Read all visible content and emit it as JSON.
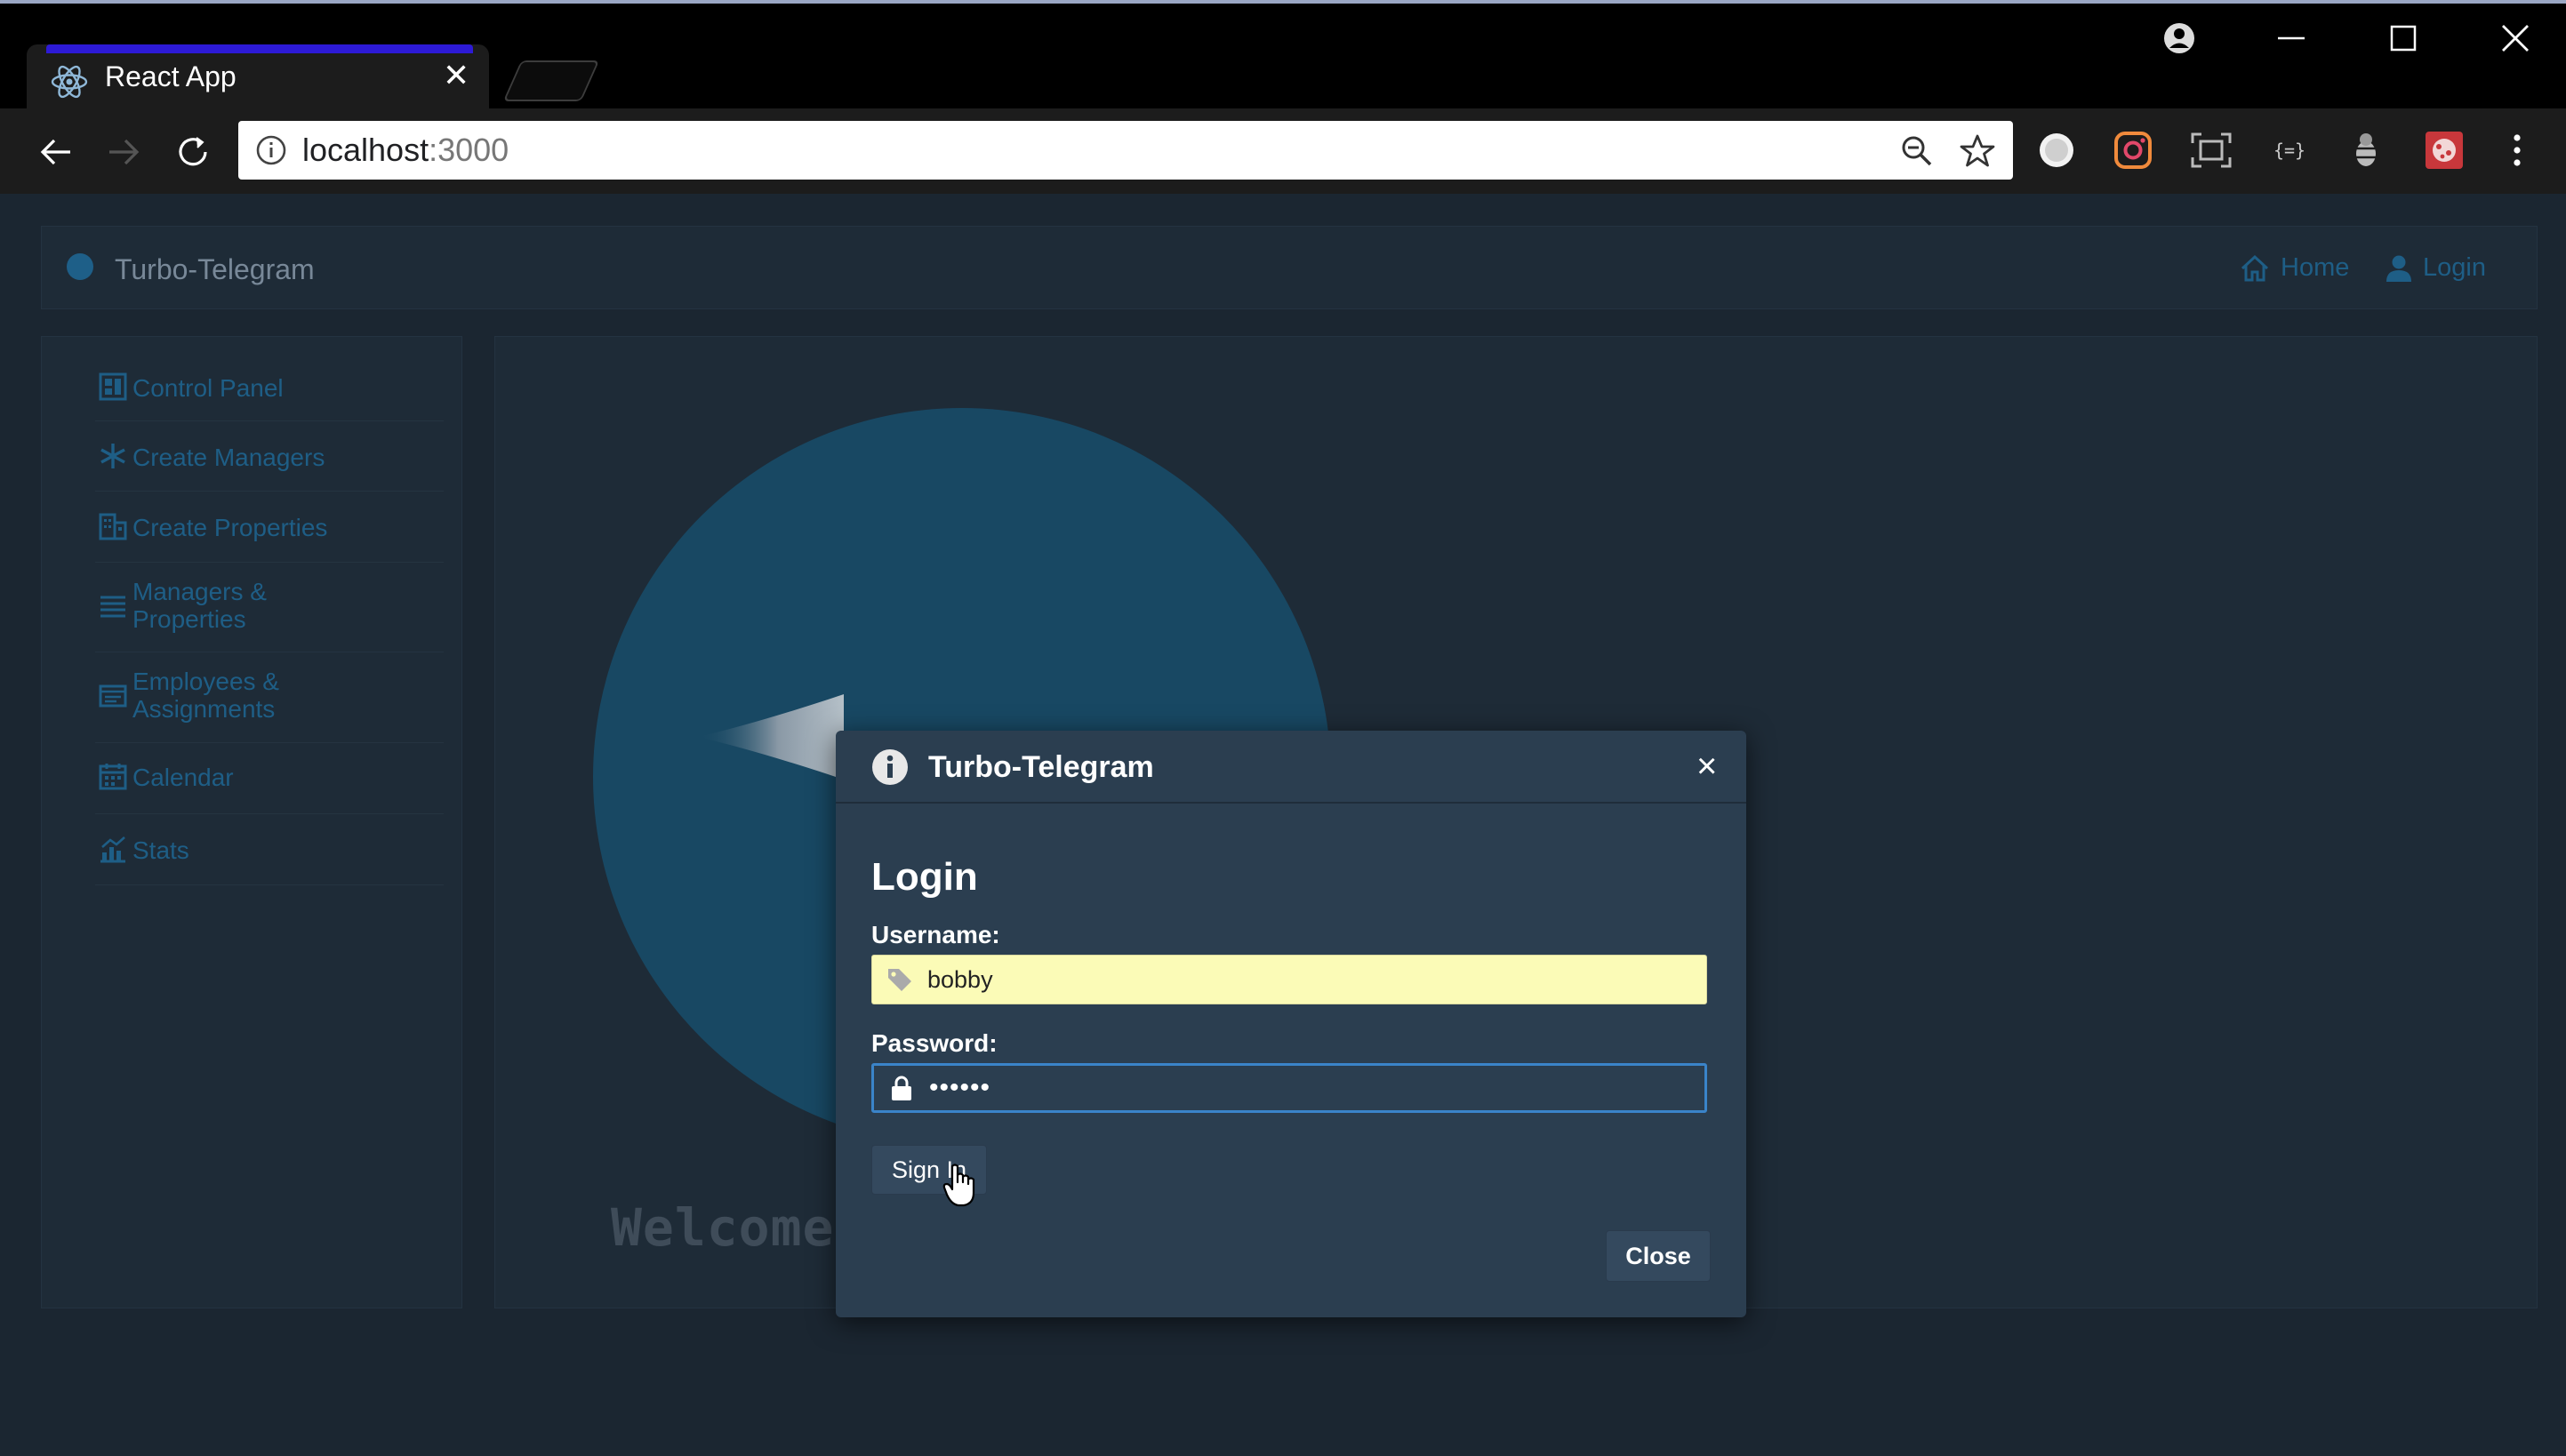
{
  "browser": {
    "tab_title": "React App",
    "tab_favicon": "react-icon",
    "tab_close": "✕",
    "url_host": "localhost",
    "url_port": ":3000",
    "window_controls": [
      "minimize-icon",
      "maximize-icon",
      "close-icon"
    ],
    "extensions": [
      "extension-circle-icon",
      "instagram-icon",
      "screenshot-icon",
      "json-icon",
      "bug-icon",
      "cookie-icon",
      "menu-icon"
    ]
  },
  "navbar": {
    "brand": "Turbo-Telegram",
    "links": [
      {
        "label": "Home",
        "icon": "home-icon"
      },
      {
        "label": "Login",
        "icon": "user-icon"
      }
    ]
  },
  "sidebar": {
    "items": [
      {
        "label": "Control Panel",
        "icon": "dashboard-icon"
      },
      {
        "label": "Create Managers",
        "icon": "asterisk-icon"
      },
      {
        "label": "Create Properties",
        "icon": "building-icon"
      },
      {
        "label": "Managers & Properties",
        "icon": "list-icon"
      },
      {
        "label": "Employees & Assignments",
        "icon": "id-card-icon"
      },
      {
        "label": "Calendar",
        "icon": "calendar-icon"
      },
      {
        "label": "Stats",
        "icon": "chart-icon"
      }
    ]
  },
  "main": {
    "welcome": "Welcome to Turbo-Telegram!"
  },
  "modal": {
    "title": "Turbo-Telegram",
    "close_x": "×",
    "heading": "Login",
    "username_label": "Username:",
    "username_value": "bobby",
    "password_label": "Password:",
    "password_value": "••••••",
    "signin_label": "Sign In",
    "close_label": "Close"
  },
  "colors": {
    "page_bg": "#1b2631",
    "panel_bg": "#1e2b37",
    "link": "#1e5e86",
    "modal_bg": "#2b3e50",
    "autofill_bg": "#fbfbb7",
    "focus_border": "#3a84c9",
    "tab_accent": "#2d1ad6"
  }
}
